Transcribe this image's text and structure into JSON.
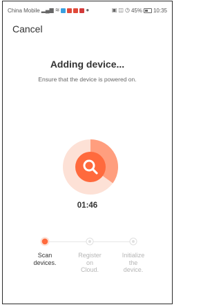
{
  "status_bar": {
    "carrier": "China Mobile",
    "battery": "45%",
    "time": "10:35",
    "icons_left": [
      "signal-icon",
      "wifi-icon",
      "app-icon-1",
      "app-icon-2",
      "app-icon-3",
      "app-icon-4",
      "chat-icon"
    ],
    "icons_right": [
      "nfc-icon",
      "vibrate-icon",
      "alarm-icon",
      "battery-icon"
    ]
  },
  "header": {
    "cancel_label": "Cancel"
  },
  "main": {
    "title": "Adding device...",
    "subtitle": "Ensure that the device is powered on.",
    "timer": "01:46",
    "progress_fraction": 0.35,
    "accent_color": "#ff6a3d",
    "icon": "search-icon"
  },
  "steps": [
    {
      "line1": "Scan",
      "line2": "devices.",
      "line3": "",
      "state": "active"
    },
    {
      "line1": "Register",
      "line2": "on",
      "line3": "Cloud.",
      "state": "pending"
    },
    {
      "line1": "Initialize",
      "line2": "the",
      "line3": "device.",
      "state": "pending"
    }
  ]
}
